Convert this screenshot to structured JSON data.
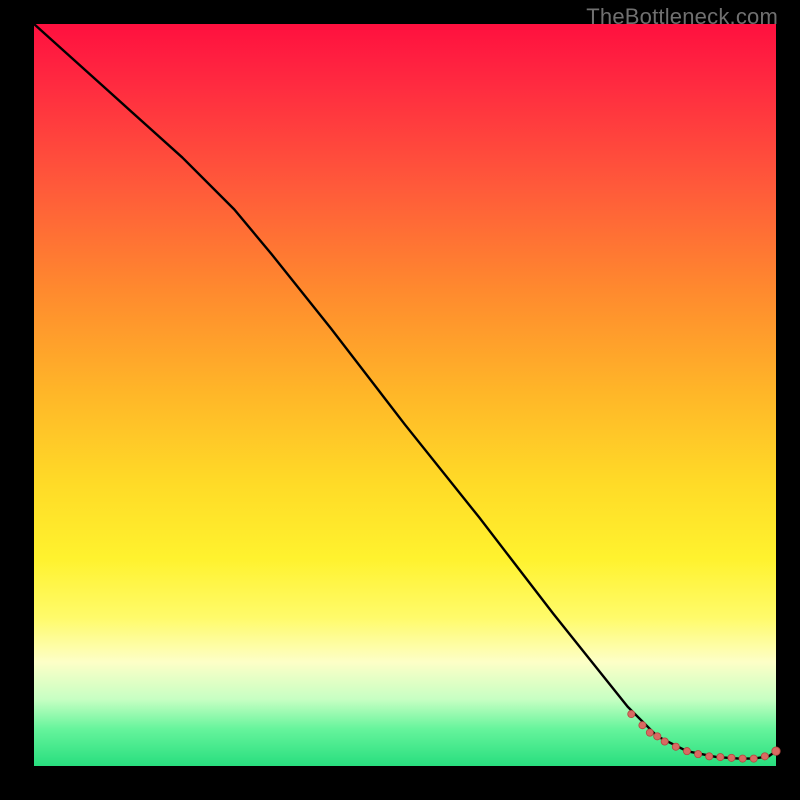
{
  "watermark": "TheBottleneck.com",
  "colors": {
    "frame_background": "#000000",
    "gradient_top": "#ff103f",
    "gradient_bottom": "#28de7e",
    "curve_stroke": "#000000",
    "marker_fill": "#d86a62",
    "marker_stroke": "#b4463f"
  },
  "chart_data": {
    "type": "line",
    "title": "",
    "xlabel": "",
    "ylabel": "",
    "xlim": [
      0,
      100
    ],
    "ylim": [
      0,
      100
    ],
    "grid": false,
    "legend": false,
    "series": [
      {
        "name": "black-curve",
        "kind": "line",
        "x": [
          0,
          10,
          20,
          27,
          32,
          40,
          50,
          60,
          70,
          80,
          84,
          88,
          92,
          95,
          97,
          99,
          100
        ],
        "y": [
          100,
          91,
          82,
          75,
          69,
          59,
          46,
          33.5,
          20.5,
          8,
          4,
          2,
          1.2,
          1.0,
          1.0,
          1.3,
          2.0
        ]
      },
      {
        "name": "highlight-markers",
        "kind": "scatter",
        "x": [
          80.5,
          82,
          83,
          84,
          85,
          86.5,
          88,
          89.5,
          91,
          92.5,
          94,
          95.5,
          97,
          98.5,
          100
        ],
        "y": [
          7.0,
          5.5,
          4.5,
          4.0,
          3.3,
          2.6,
          2.0,
          1.6,
          1.3,
          1.2,
          1.1,
          1.0,
          1.0,
          1.3,
          2.0
        ]
      }
    ]
  }
}
